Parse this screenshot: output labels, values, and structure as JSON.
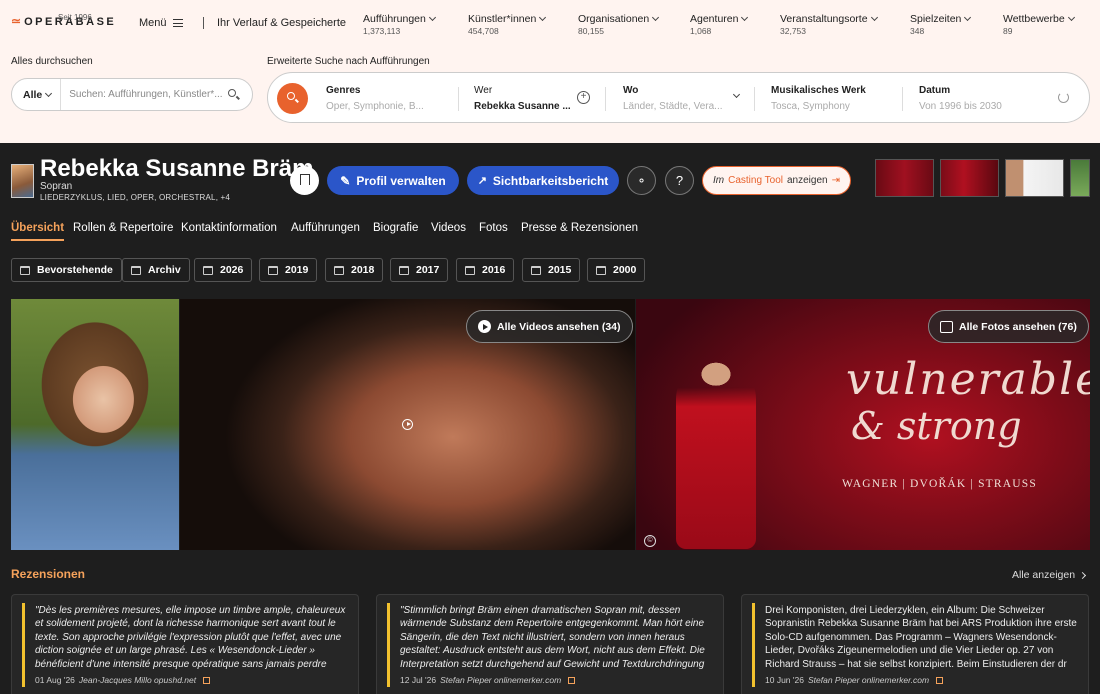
{
  "topbar": {
    "logo_text": "OPERABASE",
    "logo_sub": "Seit 1996",
    "menu_label": "Menü",
    "history_label": "Ihr Verlauf & Gespeicherte",
    "stats": [
      {
        "label": "Aufführungen",
        "count": "1,373,113"
      },
      {
        "label": "Künstler*innen",
        "count": "454,708"
      },
      {
        "label": "Organisationen",
        "count": "80,155"
      },
      {
        "label": "Agenturen",
        "count": "1,068"
      },
      {
        "label": "Veranstaltungsorte",
        "count": "32,753"
      },
      {
        "label": "Spielzeiten",
        "count": "348"
      },
      {
        "label": "Wettbewerbe",
        "count": "89"
      }
    ]
  },
  "search": {
    "title": "Alles durchsuchen",
    "scope": "Alle",
    "placeholder": "Suchen: Aufführungen, Künstler*..."
  },
  "advanced": {
    "title": "Erweiterte Suche nach Aufführungen",
    "fields": [
      {
        "title": "Genres",
        "value": "Oper, Symphonie, B..."
      },
      {
        "title": "Wer",
        "value": "Rebekka Susanne ..."
      },
      {
        "title": "Wo",
        "value": "Länder, Städte, Vera..."
      },
      {
        "title": "Musikalisches Werk",
        "value": "Tosca, Symphony"
      },
      {
        "title": "Datum",
        "value": "Von 1996 bis 2030"
      }
    ]
  },
  "profile": {
    "name": "Rebekka Susanne Bräm",
    "voice": "Sopran",
    "genres": "LIEDERZYKLUS, LIED, OPER, ORCHESTRAL, +4",
    "manage_label": "Profil verwalten",
    "visibility_label": "Sichtbarkeitsbericht",
    "help_label": "?",
    "casting_prefix": "Im",
    "casting_highlight": "Casting Tool",
    "casting_suffix": "anzeigen"
  },
  "tabs": [
    "Übersicht",
    "Rollen & Repertoire",
    "Kontaktinformation",
    "Aufführungen",
    "Biografie",
    "Videos",
    "Fotos",
    "Presse & Rezensionen"
  ],
  "years": [
    "Bevorstehende",
    "Archiv",
    "2026",
    "2019",
    "2018",
    "2017",
    "2016",
    "2015",
    "2000"
  ],
  "media": {
    "videos_label": "Alle Videos ansehen (34)",
    "photos_label": "Alle Fotos ansehen (76)",
    "album_title_1": "vulnerable",
    "album_title_2": "& strong",
    "album_composers": "WAGNER | DVOŘÁK | STRAUSS",
    "copyright": "©"
  },
  "reviews": {
    "title": "Rezensionen",
    "show_all": "Alle anzeigen",
    "items": [
      {
        "text": "\"Dès les premières mesures, elle impose un timbre ample, chaleureux et solidement projeté, dont la richesse harmonique sert avant tout le texte. Son approche privilégie l'expression plutôt que l'effet, avec une diction soignée et un large phrasé. Les « Wesendonck-Lieder » bénéficient d'une intensité presque opératique sans jamais perdre",
        "date": "01 Aug '26",
        "source": "Jean-Jacques Millo opushd.net"
      },
      {
        "text": "\"Stimmlich bringt Bräm einen dramatischen Sopran mit, dessen wärmende Substanz dem Repertoire entgegenkommt. Man hört eine Sängerin, die den Text nicht illustriert, sondern von innen heraus gestaltet: Ausdruck entsteht aus dem Wort, nicht aus dem Effekt. Die Interpretation setzt durchgehend auf Gewicht und Textdurchdringung",
        "date": "12 Jul '26",
        "source": "Stefan Pieper onlinemerker.com"
      },
      {
        "text": "Drei Komponisten, drei Liederzyklen, ein Album: Die Schweizer Sopranistin Rebekka Susanne Bräm hat bei ARS Produktion ihre erste Solo-CD aufgenommen. Das Programm – Wagners Wesendonck-Lieder, Dvořáks Zigeunermelodien und die Vier Lieder op. 27 von Richard Strauss – hat sie selbst konzipiert. Beim Einstudieren der dr",
        "date": "10 Jun '26",
        "source": "Stefan Pieper onlinemerker.com"
      }
    ]
  },
  "colors": {
    "accent": "#e8622d",
    "primary_button": "#2b56c9",
    "active_tab": "#f5a25b",
    "review_bar": "#f2c12e"
  }
}
